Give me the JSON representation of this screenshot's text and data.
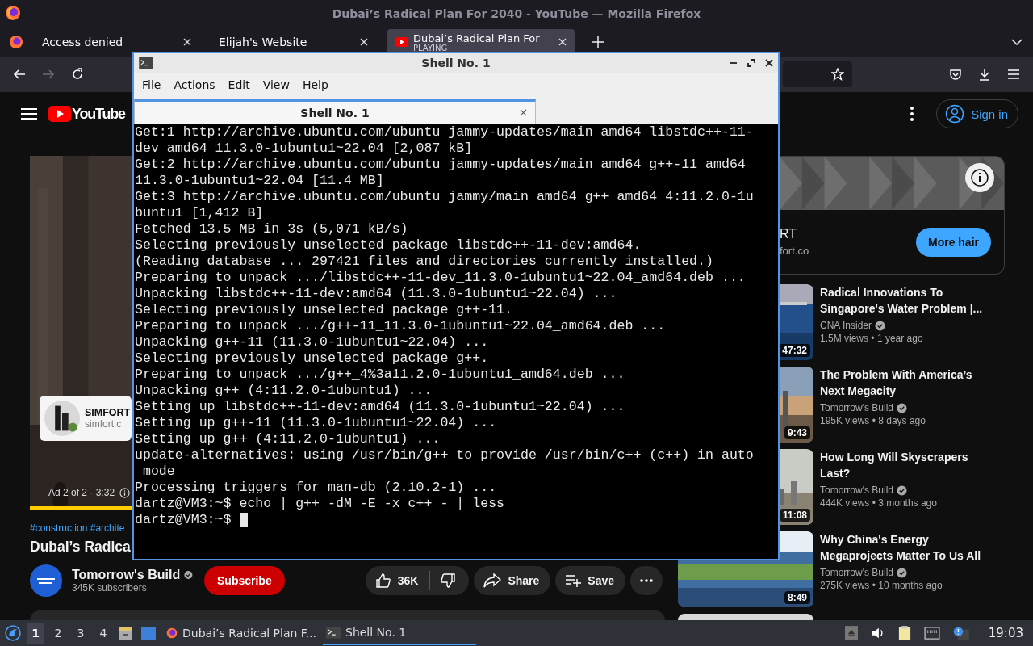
{
  "window": {
    "title": "Dubai’s Radical Plan For 2040 - YouTube — Mozilla Firefox"
  },
  "tabs": [
    {
      "label": "Access denied",
      "selected": false
    },
    {
      "label": "Elijah's Website",
      "selected": false
    },
    {
      "label": "Dubai’s Radical Plan For",
      "sublabel": "PLAYING",
      "selected": true
    }
  ],
  "nav": {
    "forward_disabled": true
  },
  "youtube": {
    "logo": "YouTube",
    "sign_in": "Sign in",
    "player": {
      "ad_label": "Ad 2 of 2 · 3:32",
      "ad_progress": {
        "level": 1
      },
      "overlay_name": "SIMFORT",
      "overlay_url": "simfort.c"
    },
    "hashtags": "#construction #archite",
    "title": "Dubai’s Radical",
    "channel": {
      "name": "Tomorrow's Build",
      "verified": true,
      "subscribers": "345K subscribers",
      "subscribe": "Subscribe"
    },
    "actions": {
      "likes": "36K",
      "share": "Share",
      "save": "Save"
    },
    "companion_ad": {
      "name": "RT",
      "url": "fort.co",
      "button": "More hair"
    },
    "related": [
      {
        "title": "Radical Innovations To Singapore's Water Problem |...",
        "channel": "CNA Insider",
        "verified": true,
        "meta": "1.5M views • 1 year ago",
        "duration": "47:32",
        "kind": "sea"
      },
      {
        "title": "The Problem With America’s Next Megacity",
        "channel": "Tomorrow's Build",
        "verified": true,
        "meta": "195K views • 8 days ago",
        "duration": "9:43",
        "kind": "sunset"
      },
      {
        "title": "How Long Will Skyscrapers Last?",
        "channel": "Tomorrow's Build",
        "verified": true,
        "meta": "444K views • 3 months ago",
        "duration": "11:08",
        "kind": "city"
      },
      {
        "title": "Why China's Energy Megaprojects Matter To Us All",
        "channel": "Tomorrow's Build",
        "verified": true,
        "meta": "275K views • 10 months ago",
        "duration": "8:49",
        "kind": "solar"
      }
    ]
  },
  "terminal": {
    "title": "Shell No. 1",
    "menu": [
      "File",
      "Actions",
      "Edit",
      "View",
      "Help"
    ],
    "tab": "Shell No. 1",
    "lines": [
      "Get:1 http://archive.ubuntu.com/ubuntu jammy-updates/main amd64 libstdc++-11-",
      "dev amd64 11.3.0-1ubuntu1~22.04 [2,087 kB]",
      "Get:2 http://archive.ubuntu.com/ubuntu jammy-updates/main amd64 g++-11 amd64",
      "11.3.0-1ubuntu1~22.04 [11.4 MB]",
      "Get:3 http://archive.ubuntu.com/ubuntu jammy/main amd64 g++ amd64 4:11.2.0-1u",
      "buntu1 [1,412 B]",
      "Fetched 13.5 MB in 3s (5,071 kB/s)",
      "Selecting previously unselected package libstdc++-11-dev:amd64.",
      "(Reading database ... 297421 files and directories currently installed.)",
      "Preparing to unpack .../libstdc++-11-dev_11.3.0-1ubuntu1~22.04_amd64.deb ...",
      "Unpacking libstdc++-11-dev:amd64 (11.3.0-1ubuntu1~22.04) ...",
      "Selecting previously unselected package g++-11.",
      "Preparing to unpack .../g++-11_11.3.0-1ubuntu1~22.04_amd64.deb ...",
      "Unpacking g++-11 (11.3.0-1ubuntu1~22.04) ...",
      "Selecting previously unselected package g++.",
      "Preparing to unpack .../g++_4%3a11.2.0-1ubuntu1_amd64.deb ...",
      "Unpacking g++ (4:11.2.0-1ubuntu1) ...",
      "Setting up libstdc++-11-dev:amd64 (11.3.0-1ubuntu1~22.04) ...",
      "Setting up g++-11 (11.3.0-1ubuntu1~22.04) ...",
      "Setting up g++ (4:11.2.0-1ubuntu1) ...",
      "update-alternatives: using /usr/bin/g++ to provide /usr/bin/c++ (c++) in auto",
      " mode",
      "Processing triggers for man-db (2.10.2-1) ...",
      "dartz@VM3:~$ echo | g++ -dM -E -x c++ - | less"
    ],
    "prompt": "dartz@VM3:~$"
  },
  "taskbar": {
    "workspaces": [
      {
        "label": "1",
        "selected": true
      },
      {
        "label": "2",
        "selected": false
      },
      {
        "label": "3",
        "selected": false
      },
      {
        "label": "4",
        "selected": false
      }
    ],
    "tasks": [
      {
        "label": "Dubai’s Radical Plan F...",
        "kind": "firefox",
        "selected": false
      },
      {
        "label": "Shell No. 1",
        "kind": "terminal",
        "selected": true
      }
    ],
    "clock": "19:03"
  }
}
